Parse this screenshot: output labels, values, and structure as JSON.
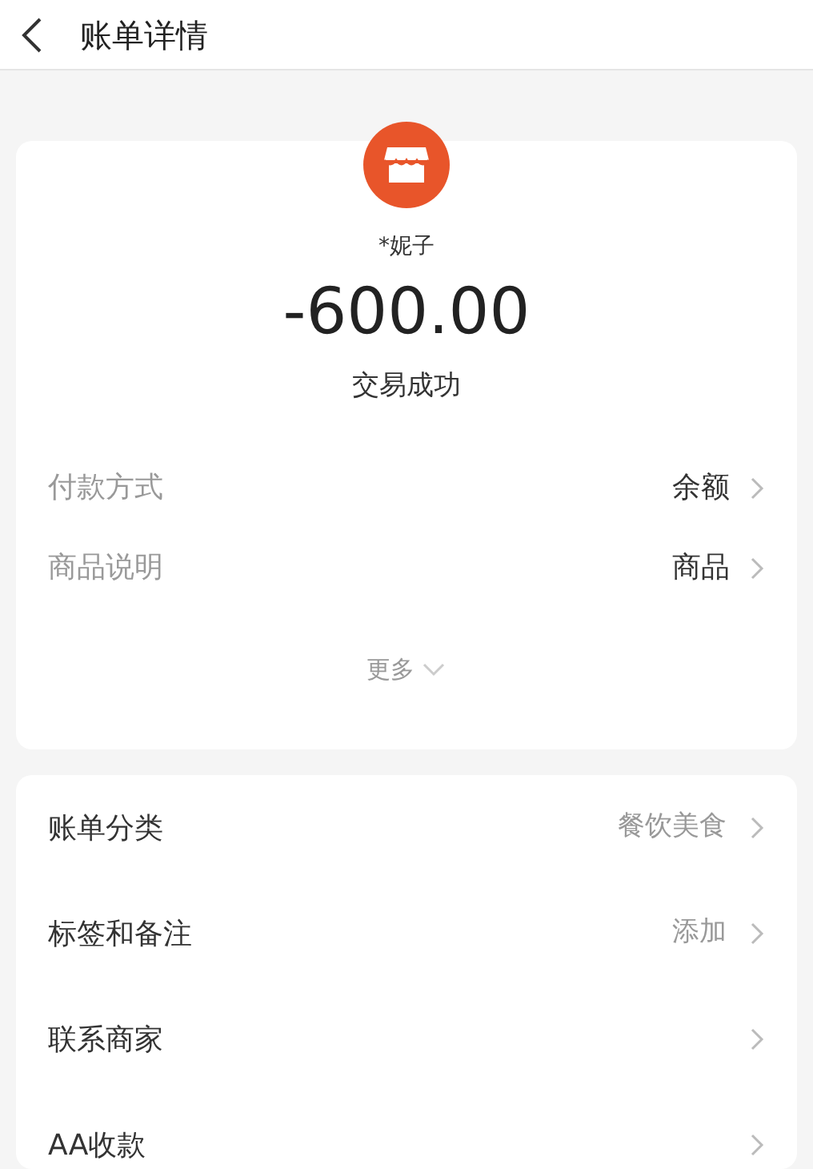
{
  "header": {
    "title": "账单详情"
  },
  "summary": {
    "payee": "*妮子",
    "amount": "-600.00",
    "status": "交易成功"
  },
  "details": [
    {
      "label": "付款方式",
      "value": "余额"
    },
    {
      "label": "商品说明",
      "value": "商品"
    }
  ],
  "more": "更多",
  "actions": [
    {
      "label": "账单分类",
      "value": "餐饮美食"
    },
    {
      "label": "标签和备注",
      "value": "添加"
    },
    {
      "label": "联系商家"
    },
    {
      "label": "AA收款"
    }
  ]
}
